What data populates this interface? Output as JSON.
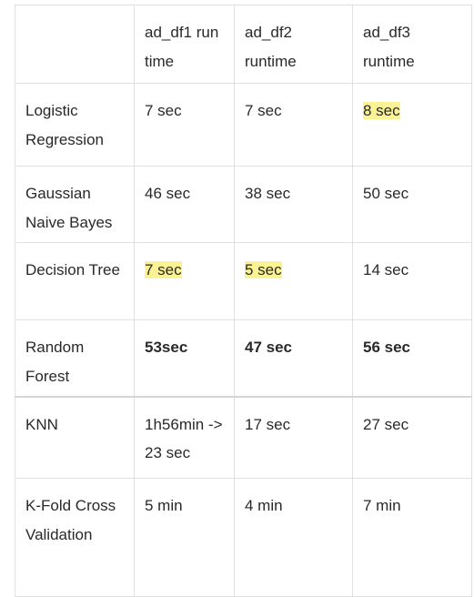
{
  "table": {
    "headers": [
      "",
      "ad_df1 run time",
      "ad_df2 runtime",
      "ad_df3 runtime"
    ],
    "rows": [
      {
        "model": "Logistic Regression",
        "df1": "7 sec",
        "df2": "7 sec",
        "df3": "8 sec"
      },
      {
        "model": "Gaussian Naive Bayes",
        "df1": "46 sec",
        "df2": "38 sec",
        "df3": "50 sec"
      },
      {
        "model": "Decision Tree",
        "df1": "7 sec",
        "df2": "5 sec",
        "df3": "14 sec"
      },
      {
        "model": "Random Forest",
        "df1": "53sec",
        "df2": "47 sec",
        "df3": "56 sec"
      },
      {
        "model": "KNN",
        "df1": "1h56min -> 23 sec",
        "df2": "17 sec",
        "df3": "27 sec"
      },
      {
        "model": "K-Fold Cross Validation",
        "df1": "5 min",
        "df2": "4 min",
        "df3": "7 min"
      }
    ]
  },
  "colors": {
    "highlight": "#fbf393",
    "border": "#e0e0e0",
    "text": "#292929"
  }
}
